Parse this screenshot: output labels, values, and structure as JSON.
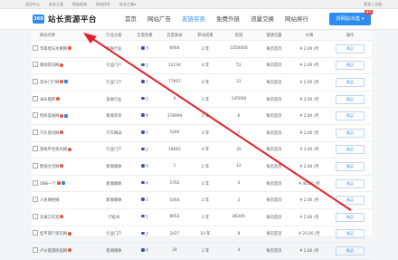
{
  "topbar": {
    "links": [
      "会员中心",
      "站长工具",
      "网站收录",
      "网站排名",
      "站长工具▾"
    ],
    "right_text": "登录 | 注册"
  },
  "header": {
    "logo_icon": "360",
    "logo_text": "站长资源平台",
    "cta_label": "找网站/出售 ▾",
    "cta_badge": "推荐"
  },
  "nav": [
    "首页",
    "网站广告",
    "友链买卖",
    "免费外链",
    "流量交换",
    "网站排行"
  ],
  "nav_active_index": 2,
  "colors": {
    "accent": "#2d8cf0",
    "hot": "#e55533",
    "arrow": "#e0202a",
    "dot": "#3a4fa8"
  },
  "table": {
    "headers": [
      "网站名称",
      "行业分类",
      "百度权重",
      "百度收录",
      "移动权重",
      "反链",
      "链接位置",
      "价格",
      "操作"
    ],
    "rows": [
      {
        "name": "华南地方水果网",
        "hot": true,
        "vip": false,
        "cat": "美食行业",
        "br": "3",
        "idx": "6464",
        "mw": "3 年",
        "bl": "1056000",
        "pos": "每页首页",
        "price": "¥ 2.00 /月",
        "action": "购买"
      },
      {
        "name": "新闻资讯网",
        "hot": true,
        "vip": false,
        "cat": "行业门户",
        "br": "2",
        "idx": "23134",
        "mw": "4 年",
        "bl": "51",
        "pos": "每页首页",
        "price": "¥ 2.00 /月",
        "action": "购买"
      },
      {
        "name": "苏州门户网",
        "hot": true,
        "vip": true,
        "cat": "行业门户",
        "br": "1",
        "idx": "77607",
        "mw": "4 年",
        "bl": "21",
        "pos": "每页首页",
        "price": "¥ 2.00 /月",
        "action": "购买"
      },
      {
        "name": "米乐图库",
        "hot": true,
        "vip": false,
        "cat": "美食行业",
        "br": "2",
        "idx": "0",
        "mw": "1 年",
        "bl": "145000",
        "pos": "每页首页",
        "price": "¥ 2.00 /月",
        "action": "购买"
      },
      {
        "name": "时尚美食网",
        "hot": true,
        "vip": true,
        "cat": "新闻资讯",
        "br": "4",
        "idx": "378999",
        "mw": "1 年",
        "bl": "6",
        "pos": "每页首页",
        "price": "¥ 2.00 /月",
        "action": "购买"
      },
      {
        "name": "汽车资讯网",
        "hot": true,
        "vip": false,
        "cat": "汽车网站",
        "br": "1",
        "idx": "5440",
        "mw": "3 年",
        "bl": "1",
        "pos": "每页首页",
        "price": "¥ 2.00 /月",
        "action": "购买"
      },
      {
        "name": "游戏平台资讯网",
        "hot": true,
        "vip": false,
        "cat": "行业门户",
        "br": "2",
        "idx": "18065",
        "mw": "4 年",
        "bl": "35",
        "pos": "每页首页",
        "price": "¥ 2.00 /月",
        "action": "购买"
      },
      {
        "name": "影视大全网",
        "hot": true,
        "vip": false,
        "cat": "新闻媒体",
        "br": "0",
        "idx": "1",
        "mw": "2 年",
        "bl": "12",
        "pos": "每页首页",
        "price": "¥ 2.00 /月",
        "action": "购买"
      },
      {
        "name": "ONE一个",
        "hot": true,
        "vip": true,
        "cat": "新闻媒体",
        "br": "4",
        "idx": "5762",
        "mw": "3 年",
        "bl": "4",
        "pos": "每页首页",
        "price": "¥ 40.00 /月",
        "action": "购买"
      },
      {
        "name": "人民财经网",
        "hot": false,
        "vip": false,
        "cat": "新闻媒体",
        "br": "1",
        "idx": "5464",
        "mw": "3 年",
        "bl": "2",
        "pos": "每页首页",
        "price": "¥ 2.00 /月",
        "action": "购买"
      },
      {
        "name": "东坡工作室",
        "hot": true,
        "vip": false,
        "cat": "IT技术",
        "br": "1",
        "idx": "8953",
        "mw": "3 年",
        "bl": "86200",
        "pos": "每页首页",
        "price": "¥ 2.00 /月",
        "action": "购买"
      },
      {
        "name": "桂平旅行资讯网",
        "hot": true,
        "vip": false,
        "cat": "行业门户",
        "br": "2",
        "idx": "2427",
        "mw": "10 年",
        "bl": "8",
        "pos": "每页首页",
        "price": "¥ 25.00 /月",
        "action": "购买"
      },
      {
        "name": "卢沙旅游民宿网",
        "hot": true,
        "vip": false,
        "cat": "新闻媒体",
        "br": "0",
        "idx": "24",
        "mw": "1 年",
        "bl": "4",
        "pos": "每页首页",
        "price": "¥ 2.00 /月",
        "action": "购买"
      }
    ]
  }
}
